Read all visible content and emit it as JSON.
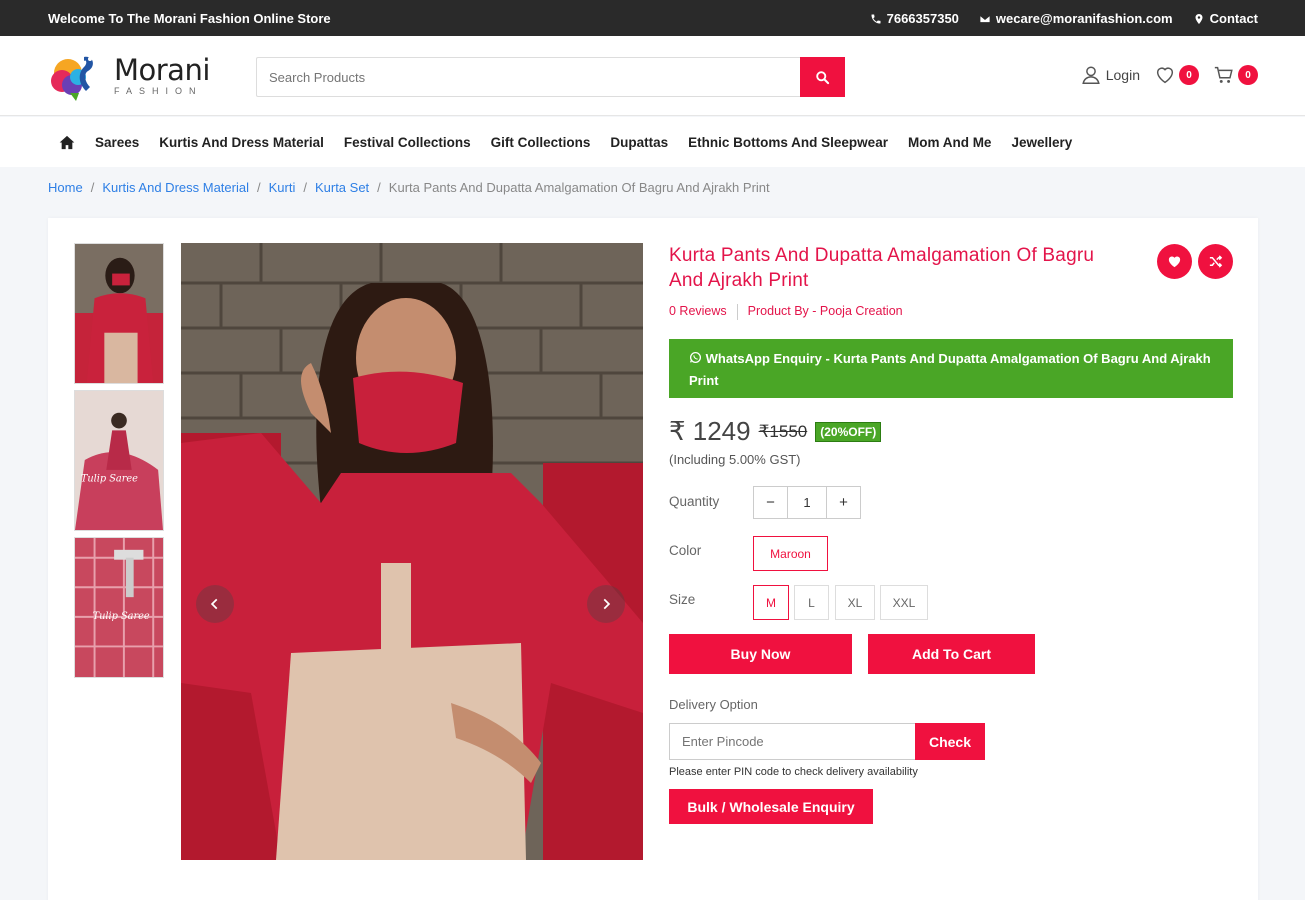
{
  "topbar": {
    "welcome": "Welcome To The Morani Fashion Online Store",
    "phone": "7666357350",
    "email": "wecare@moranifashion.com",
    "contact": "Contact"
  },
  "header": {
    "logo_name": "Morani",
    "logo_sub": "FASHION",
    "search_placeholder": "Search Products",
    "login": "Login",
    "wishlist_count": "0",
    "cart_count": "0"
  },
  "nav": {
    "items": [
      "Sarees",
      "Kurtis And Dress Material",
      "Festival Collections",
      "Gift Collections",
      "Dupattas",
      "Ethnic Bottoms And Sleepwear",
      "Mom And Me",
      "Jewellery"
    ]
  },
  "breadcrumb": {
    "items": [
      "Home",
      "Kurtis And Dress Material",
      "Kurti",
      "Kurta Set"
    ],
    "current": "Kurta Pants And Dupatta Amalgamation Of Bagru And Ajrakh Print"
  },
  "product": {
    "title": "Kurta Pants And Dupatta Amalgamation Of Bagru And Ajrakh Print",
    "reviews": "0 Reviews",
    "product_by": "Product By - Pooja Creation",
    "whatsapp": "WhatsApp Enquiry - Kurta Pants And Dupatta Amalgamation Of Bagru And Ajrakh Print",
    "price": "₹ 1249",
    "mrp": "₹1550",
    "discount": "(20%OFF)",
    "gst_note": "(Including 5.00% GST)",
    "quantity_label": "Quantity",
    "quantity": "1",
    "color_label": "Color",
    "color": "Maroon",
    "size_label": "Size",
    "sizes": [
      "M",
      "L",
      "XL",
      "XXL"
    ],
    "selected_size": "M",
    "buy_now": "Buy Now",
    "add_to_cart": "Add To Cart",
    "delivery_label": "Delivery Option",
    "pincode_placeholder": "Enter Pincode",
    "check": "Check",
    "pin_note": "Please enter PIN code to check delivery availability",
    "bulk": "Bulk / Wholesale Enquiry"
  },
  "colors": {
    "accent": "#f0113f",
    "title": "#e3144a",
    "whatsapp": "#4aa626",
    "link": "#2e7fe5",
    "topbar": "#2a2a2a"
  },
  "icons": [
    "phone-icon",
    "mail-icon",
    "location-icon",
    "search-icon",
    "user-icon",
    "heart-icon",
    "cart-icon",
    "home-icon",
    "whatsapp-icon",
    "shuffle-icon",
    "chevron-left-icon",
    "chevron-right-icon"
  ]
}
